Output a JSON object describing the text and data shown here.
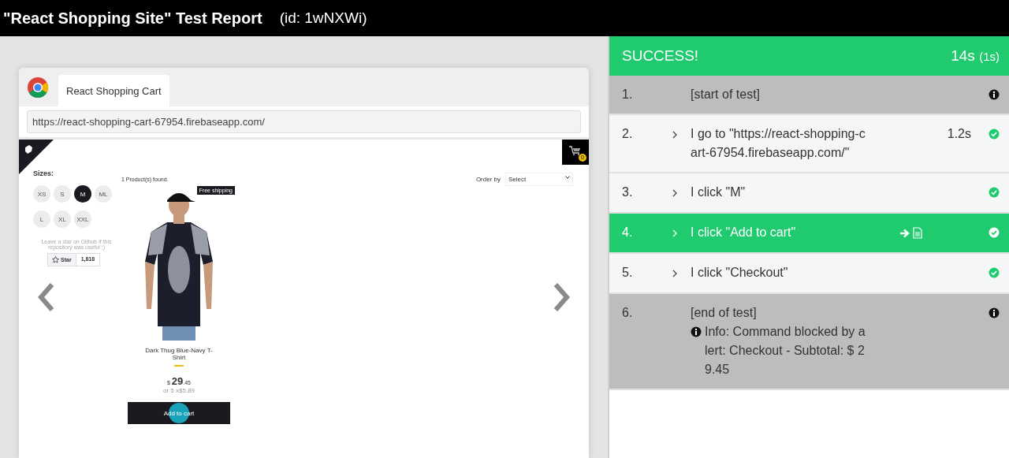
{
  "header": {
    "title": "\"React Shopping Site\" Test Report",
    "id": "(id: 1wNXWi)"
  },
  "browser": {
    "tab": "React Shopping Cart",
    "url": "https://react-shopping-cart-67954.firebaseapp.com/",
    "page": {
      "sizes_label": "Sizes:",
      "sizes": [
        {
          "label": "XS",
          "selected": false
        },
        {
          "label": "S",
          "selected": false
        },
        {
          "label": "M",
          "selected": true
        },
        {
          "label": "ML",
          "selected": false
        },
        {
          "label": "L",
          "selected": false
        },
        {
          "label": "XL",
          "selected": false
        },
        {
          "label": "XXL",
          "selected": false
        }
      ],
      "star_note": "Leave a star on Github if this repository was useful :)",
      "star_button": "Star",
      "star_count": "1,818",
      "products_found": "1 Product(s) found.",
      "order_label": "Order by",
      "order_select": "Select",
      "cart_count": "0",
      "product": {
        "badge": "Free shipping",
        "name": "Dark Thug Blue-Navy T-Shirt",
        "currency": "$",
        "price_int": "29",
        "price_dec": ".45",
        "installment": "or 5 x$5.89",
        "button": "Add to cart",
        "clicked": true
      }
    }
  },
  "result": {
    "status": "SUCCESS!",
    "duration": "14s",
    "sub_duration": "(1s)"
  },
  "steps": [
    {
      "number": "1.",
      "kind": "marker",
      "text": "[start of test]",
      "passed": false,
      "selected": false,
      "attachments": false
    },
    {
      "number": "2.",
      "kind": "step",
      "text": "I go to \"https://react-shopping-cart-67954.firebaseapp.com/\"",
      "duration": "1.2s",
      "passed": true,
      "selected": false,
      "attachments": false
    },
    {
      "number": "3.",
      "kind": "step",
      "text": "I click \"M\"",
      "passed": true,
      "selected": false,
      "attachments": false
    },
    {
      "number": "4.",
      "kind": "step",
      "text": "I click \"Add to cart\"",
      "passed": true,
      "selected": true,
      "attachments": true
    },
    {
      "number": "5.",
      "kind": "step",
      "text": "I click \"Checkout\"",
      "passed": true,
      "selected": false,
      "attachments": false
    },
    {
      "number": "6.",
      "kind": "marker",
      "text": "[end of test]",
      "message": "Info: Command blocked by alert: Checkout - Subtotal: $ 29.45",
      "passed": false,
      "selected": false,
      "attachments": false
    }
  ]
}
